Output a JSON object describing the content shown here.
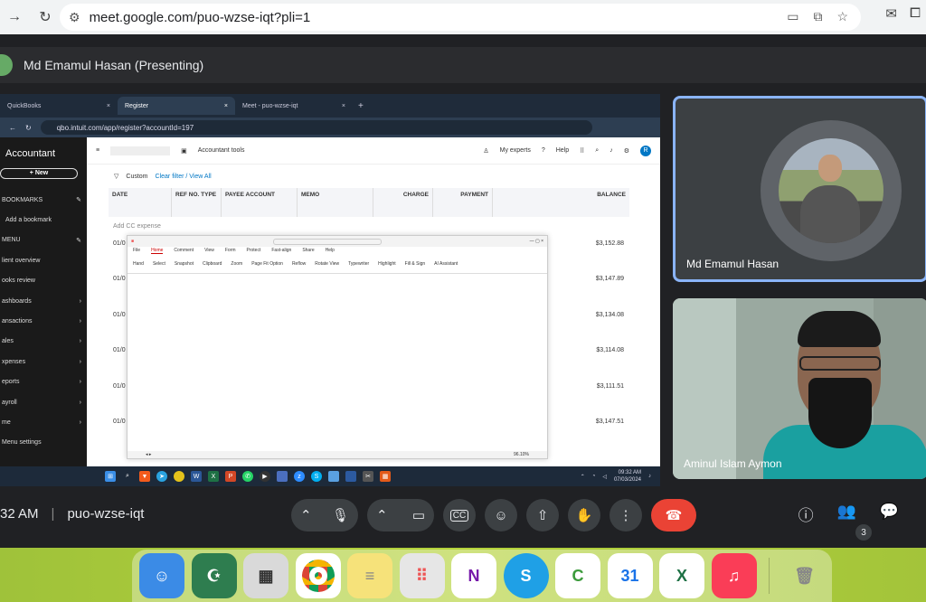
{
  "browser": {
    "url": "meet.google.com/puo-wzse-iqt?pli=1",
    "back_icon": "arrow-right-icon",
    "reload_icon": "reload-icon"
  },
  "meet": {
    "presenter_label": "Md Emamul Hasan (Presenting)",
    "time": "32 AM",
    "meeting_code": "puo-wzse-iqt",
    "participants_count": "3",
    "tiles": [
      {
        "name": "Md Emamul Hasan"
      },
      {
        "name": "Aminul Islam Aymon"
      }
    ]
  },
  "shared_screen": {
    "tabs": [
      {
        "label": "QuickBooks"
      },
      {
        "label": "Register"
      },
      {
        "label": "Meet - puo-wzse-iqt"
      }
    ],
    "url": "qbo.intuit.com/app/register?accountId=197",
    "sidebar": {
      "title": "Accountant",
      "new_label": "+ New",
      "items": [
        {
          "label": "BOOKMARKS"
        },
        {
          "label": "Add a bookmark"
        },
        {
          "label": "MENU"
        },
        {
          "label": "lient overview"
        },
        {
          "label": "ooks review"
        },
        {
          "label": "ashboards"
        },
        {
          "label": "ansactions"
        },
        {
          "label": "ales"
        },
        {
          "label": "xpenses"
        },
        {
          "label": "eports"
        },
        {
          "label": "ayroll"
        },
        {
          "label": "me"
        },
        {
          "label": "Menu settings"
        }
      ]
    },
    "topbar": {
      "accountant_tools": "Accountant tools",
      "my_experts": "My experts",
      "help": "Help",
      "avatar": "R"
    },
    "filter": {
      "custom": "Custom",
      "clear": "Clear filter / View All"
    },
    "columns": [
      "DATE",
      "REF NO. TYPE",
      "PAYEE ACCOUNT",
      "MEMO",
      "CHARGE",
      "PAYMENT",
      "BALANCE"
    ],
    "add_expense": "Add CC expense",
    "rows": [
      {
        "date": "01/0",
        "balance": "$3,152.88"
      },
      {
        "date": "01/0",
        "balance": "$3,147.89"
      },
      {
        "date": "01/0",
        "balance": "$3,134.08"
      },
      {
        "date": "01/0",
        "balance": "$3,114.08"
      },
      {
        "date": "01/0",
        "balance": "$3,111.51"
      },
      {
        "date": "01/0",
        "balance": "$3,147.51"
      }
    ],
    "pdf": {
      "menu": [
        "File",
        "Home",
        "Comment",
        "View",
        "Form",
        "Protect",
        "Fast-align",
        "Share",
        "Help"
      ],
      "ribbon": [
        "Hand",
        "Select",
        "Snapshot",
        "Clipboard",
        "Zoom",
        "Page Fit Option",
        "Reflow",
        "Rotate View",
        "Typewriter",
        "Highlight",
        "Fill & Sign",
        "AI Assistant"
      ],
      "footer_zoom": "96.10%"
    },
    "taskbar": {
      "clock_time": "09:32 AM",
      "clock_date": "07/03/2024"
    }
  },
  "dock": {
    "apps": [
      {
        "name": "finder",
        "color": "#3b8be6"
      },
      {
        "name": "quran",
        "color": "#2e7d4f"
      },
      {
        "name": "calculator",
        "color": "#d9d9d9"
      },
      {
        "name": "chrome",
        "color": "#ffffff"
      },
      {
        "name": "notes",
        "color": "#f6e27a"
      },
      {
        "name": "launchpad",
        "color": "#e6e6e6"
      },
      {
        "name": "onenote",
        "color": "#ffffff"
      },
      {
        "name": "skype",
        "color": "#1fa0e6"
      },
      {
        "name": "camtasia",
        "color": "#ffffff"
      },
      {
        "name": "calendar",
        "color": "#ffffff"
      },
      {
        "name": "excel",
        "color": "#ffffff"
      },
      {
        "name": "music",
        "color": "#fa3d57"
      },
      {
        "name": "trash",
        "color": "#dfe3e3"
      }
    ],
    "calendar_day": "31",
    "onenote_letter": "N",
    "skype_letter": "S",
    "excel_letter": "X"
  }
}
